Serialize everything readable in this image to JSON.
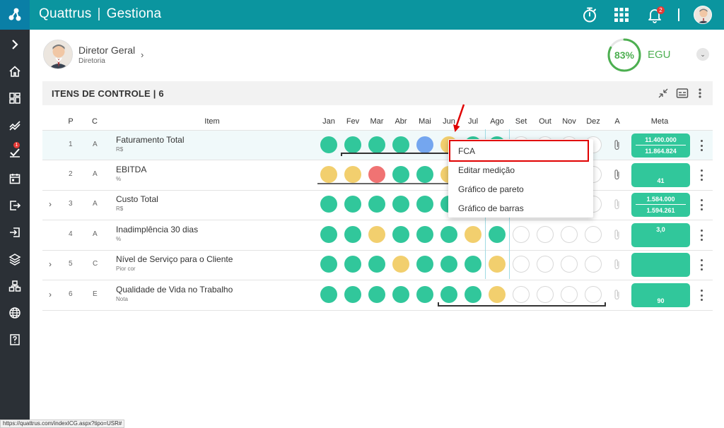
{
  "topbar": {
    "brand_left": "Quattrus",
    "brand_sep": "|",
    "brand_right": "Gestiona",
    "notification_count": "2",
    "icons": [
      "stopwatch-icon",
      "apps-grid-icon",
      "bell-icon",
      "avatar"
    ]
  },
  "sidebar": {
    "items": [
      {
        "icon": "chevron-right-icon"
      },
      {
        "icon": "home-icon"
      },
      {
        "icon": "dashboard-icon"
      },
      {
        "icon": "trend-icon"
      },
      {
        "icon": "tasks-icon",
        "badge": "1"
      },
      {
        "icon": "calendar-icon"
      },
      {
        "icon": "logout-icon"
      },
      {
        "icon": "login-icon"
      },
      {
        "icon": "layers-icon"
      },
      {
        "icon": "org-chart-icon"
      },
      {
        "icon": "globe-icon"
      },
      {
        "icon": "help-icon"
      }
    ]
  },
  "profile": {
    "name": "Diretor Geral",
    "subtitle": "Diretoria",
    "egu_percent": "83%",
    "egu_value": 0.83,
    "egu_label": "EGU"
  },
  "section": {
    "title": "ITENS DE CONTROLE | 6"
  },
  "table": {
    "headers": {
      "p": "P",
      "c": "C",
      "item": "Item",
      "months": [
        "Jan",
        "Fev",
        "Mar",
        "Abr",
        "Mai",
        "Jun",
        "Jul",
        "Ago",
        "Set",
        "Out",
        "Nov",
        "Dez"
      ],
      "a": "A",
      "meta": "Meta"
    },
    "rows": [
      {
        "p": "1",
        "c": "A",
        "name": "Faturamento Total",
        "unit": "R$",
        "expandable": false,
        "statuses": [
          "green",
          "green",
          "green",
          "green",
          "blue",
          "yellow",
          "green",
          "green",
          "empty",
          "empty",
          "empty",
          "empty"
        ],
        "meta_top": "11.400.000",
        "meta_bottom": "11.864.824",
        "meta_split": true
      },
      {
        "p": "2",
        "c": "A",
        "name": "EBITDA",
        "unit": "%",
        "expandable": false,
        "statuses": [
          "yellow",
          "yellow",
          "red",
          "green",
          "green",
          "yellow",
          "green",
          "green",
          "empty",
          "empty",
          "empty",
          "empty"
        ],
        "meta_top": "",
        "meta_bottom": "41",
        "meta_split": false
      },
      {
        "p": "3",
        "c": "A",
        "name": "Custo Total",
        "unit": "R$",
        "expandable": true,
        "statuses": [
          "green",
          "green",
          "green",
          "green",
          "green",
          "green",
          "green",
          "green",
          "empty",
          "empty",
          "empty",
          "empty"
        ],
        "meta_top": "1.584.000",
        "meta_bottom": "1.594.261",
        "meta_split": true
      },
      {
        "p": "4",
        "c": "A",
        "name": "Inadimplência 30 dias",
        "unit": "%",
        "expandable": false,
        "statuses": [
          "green",
          "green",
          "yellow",
          "green",
          "green",
          "green",
          "yellow",
          "green",
          "empty",
          "empty",
          "empty",
          "empty"
        ],
        "meta_top": "3,0",
        "meta_bottom": "",
        "meta_split": false
      },
      {
        "p": "5",
        "c": "C",
        "name": "Nível de Serviço para o Cliente",
        "unit": "Pior cor",
        "expandable": true,
        "statuses": [
          "green",
          "green",
          "green",
          "yellow",
          "green",
          "green",
          "green",
          "yellow",
          "empty",
          "empty",
          "empty",
          "empty"
        ],
        "meta_top": "",
        "meta_bottom": "",
        "meta_split": false
      },
      {
        "p": "6",
        "c": "E",
        "name": "Qualidade de Vida no Trabalho",
        "unit": "Nota",
        "expandable": true,
        "statuses": [
          "green",
          "green",
          "green",
          "green",
          "green",
          "green",
          "green",
          "yellow",
          "empty",
          "empty",
          "empty",
          "empty"
        ],
        "meta_top": "",
        "meta_bottom": "90",
        "meta_split": false
      }
    ]
  },
  "context_menu": {
    "items": [
      "FCA",
      "Editar medição",
      "Gráfico de pareto",
      "Gráfico de barras"
    ],
    "highlighted": "FCA"
  },
  "status_bar": {
    "url": "https://quattrus.com/indexICG.aspx?tipo=USR#"
  },
  "colors": {
    "topbar": "#0b959f",
    "sidebar": "#2b3036",
    "green": "#31c79b",
    "yellow": "#f2cf6e",
    "red": "#f07373",
    "blue": "#74a6ef",
    "highlight_border": "#e00000"
  }
}
